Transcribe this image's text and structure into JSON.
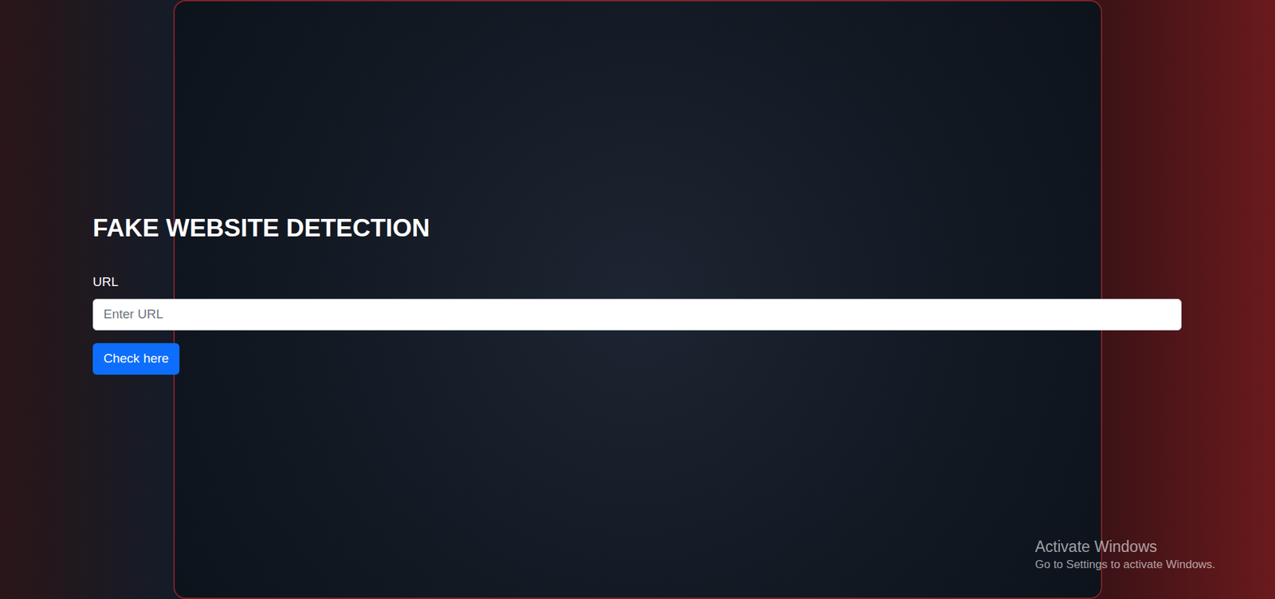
{
  "page": {
    "heading": "FAKE WEBSITE DETECTION"
  },
  "form": {
    "label": "URL",
    "placeholder": "Enter URL",
    "button": "Check here"
  },
  "watermark": {
    "title": "Activate Windows",
    "subtitle": "Go to Settings to activate Windows."
  }
}
